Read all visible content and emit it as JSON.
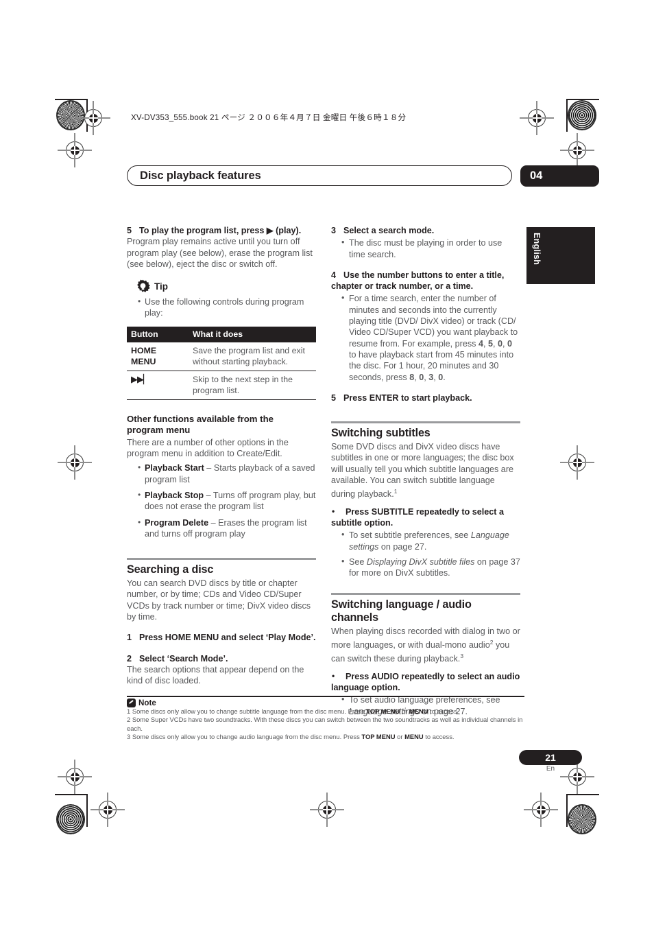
{
  "header": {
    "book_line": "XV-DV353_555.book 21 ページ ２００６年４月７日 金曜日 午後６時１８分",
    "chapter_title": "Disc playback features",
    "chapter_number": "04",
    "language_tab": "English"
  },
  "left_column": {
    "step5": {
      "number": "5",
      "heading": "To play the program list, press ▶ (play).",
      "body": "Program play remains active until you turn off program play (see below), erase the program list (see below), eject the disc or switch off."
    },
    "tip": {
      "icon": "lightbulb-gear-icon",
      "label": "Tip",
      "bullet": "Use the following controls during program play:"
    },
    "table": {
      "headers": [
        "Button",
        "What it does"
      ],
      "rows": [
        {
          "button": "HOME MENU",
          "button_line1": "HOME",
          "button_line2": "MENU",
          "description": "Save the program list and exit without starting playback."
        },
        {
          "button": "▶▶▏",
          "button_line1": "▶▶▏",
          "button_line2": "",
          "description": "Skip to the next step in the program list."
        }
      ]
    },
    "other_functions": {
      "title_line1": "Other functions available from the",
      "title_line2": "program menu",
      "body": "There are a number of other options in the program menu in addition to Create/Edit.",
      "items": [
        {
          "term": "Playback Start",
          "desc": " – Starts playback of a saved program list"
        },
        {
          "term": "Playback Stop",
          "desc": " – Turns off program play, but does not erase the program list"
        },
        {
          "term": "Program Delete",
          "desc": " – Erases the program list and turns off program play"
        }
      ]
    },
    "searching": {
      "title": "Searching a disc",
      "body": "You can search DVD discs by title or chapter number, or by time; CDs and Video CD/Super VCDs by track number or time; DivX video discs by time.",
      "step1_number": "1",
      "step1_text": "Press HOME MENU and select ‘Play Mode’.",
      "step2_number": "2",
      "step2_text": "Select ‘Search Mode’.",
      "step2_body": "The search options that appear depend on the kind of disc loaded."
    }
  },
  "right_column": {
    "step3": {
      "number": "3",
      "heading": "Select a search mode.",
      "bullet": "The disc must be playing in order to use time search."
    },
    "step4": {
      "number": "4",
      "heading": "Use the number buttons to enter a title, chapter or track number, or a time.",
      "bullet_part1": "For a time search, enter the number of minutes and seconds into the currently playing title (DVD/ DivX video) or track (CD/ Video CD/Super VCD) you want playback to resume from. For example, press ",
      "keys1": [
        "4",
        "5",
        "0",
        "0"
      ],
      "bullet_part2": " to have playback start from 45 minutes into the disc. For 1 hour, 20 minutes and 30 seconds, press ",
      "keys2": [
        "8",
        "0",
        "3",
        "0"
      ],
      "bullet_part3": "."
    },
    "step5": {
      "number": "5",
      "heading": "Press ENTER to start playback."
    },
    "subtitles": {
      "title": "Switching subtitles",
      "body_part1": "Some DVD discs and DivX video discs have subtitles in one or more languages; the disc box will usually tell you which subtitle languages are available. You can switch subtitle language during playback.",
      "body_sup": "1",
      "action": "Press SUBTITLE repeatedly to select a subtitle option.",
      "notes": [
        {
          "pre": "To set subtitle preferences, see ",
          "italic": "Language settings",
          "post": " on page 27."
        },
        {
          "pre": "See ",
          "italic": "Displaying DivX subtitle files",
          "post": " on page 37 for more on DivX subtitles."
        }
      ]
    },
    "audio": {
      "title_line1": "Switching language / audio",
      "title_line2": "channels",
      "body_part1": "When playing discs recorded with dialog in two or more languages, or with dual-mono audio",
      "body_sup1": "2",
      "body_part2": " you can switch these during playback.",
      "body_sup2": "3",
      "action": "Press AUDIO repeatedly to select an audio language option.",
      "notes": [
        {
          "pre": "To set audio language preferences, see ",
          "italic": "Language settings",
          "post": " on page 27."
        }
      ]
    }
  },
  "notes": {
    "icon": "pencil-note-icon",
    "label": "Note",
    "items": [
      {
        "num": "1",
        "pre": "Some discs only allow you to change subtitle language from the disc menu. Press ",
        "key1": "TOP MENU",
        "mid": " or ",
        "key2": "MENU",
        "post": " to access."
      },
      {
        "num": "2",
        "pre": "Some Super VCDs have two soundtracks. With these discs you can switch between the two soundtracks as well as individual channels in each.",
        "key1": "",
        "mid": "",
        "key2": "",
        "post": ""
      },
      {
        "num": "3",
        "pre": "Some discs only allow you to change audio language from the disc menu. Press ",
        "key1": "TOP MENU",
        "mid": " or ",
        "key2": "MENU",
        "post": " to access."
      }
    ]
  },
  "footer": {
    "page_number": "21",
    "page_lang": "En"
  }
}
